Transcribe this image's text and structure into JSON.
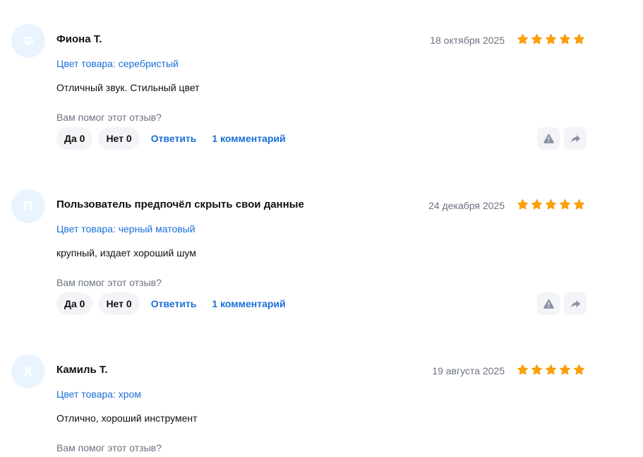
{
  "reviews": [
    {
      "avatar_letter": "Ф",
      "author": "Фиона Т.",
      "date": "18 октября 2025",
      "rating": 5,
      "variant": "Цвет товара: серебристый",
      "text": "Отличный звук. Стильный цвет",
      "helpful_question": "Вам помог этот отзыв?",
      "yes_label": "Да 0",
      "no_label": "Нет 0",
      "reply_label": "Ответить",
      "comments_label": "1 комментарий"
    },
    {
      "avatar_letter": "П",
      "author": "Пользователь предпочёл скрыть свои данные",
      "date": "24 декабря 2025",
      "rating": 5,
      "variant": "Цвет товара: черный матовый",
      "text": "крупный, издает хороший шум",
      "helpful_question": "Вам помог этот отзыв?",
      "yes_label": "Да 0",
      "no_label": "Нет 0",
      "reply_label": "Ответить",
      "comments_label": "1 комментарий"
    },
    {
      "avatar_letter": "К",
      "author": "Камиль Т.",
      "date": "19 августа 2025",
      "rating": 5,
      "variant": "Цвет товара: хром",
      "text": "Отлично, хороший инструмент",
      "helpful_question": "Вам помог этот отзыв?"
    }
  ],
  "icons": {
    "star": "star-icon",
    "report": "warning-icon",
    "share": "share-arrow-icon"
  },
  "colors": {
    "star": "#fb9f0c",
    "link": "#1a6fd9",
    "avatar_bg": "#e9f4ff",
    "pill_bg": "#f3f4f7",
    "muted_text": "#6b7280",
    "icon": "#8a93a3"
  }
}
